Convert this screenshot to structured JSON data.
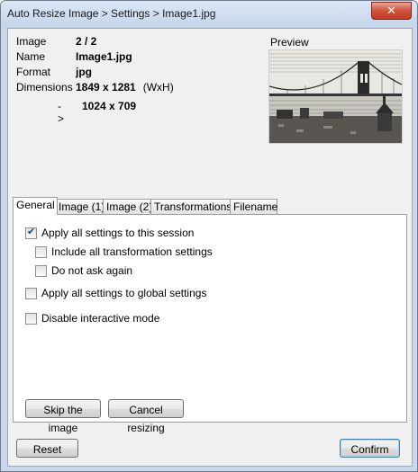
{
  "window": {
    "title": "Auto Resize Image > Settings > Image1.jpg",
    "close_glyph": "✕"
  },
  "info": {
    "image_label": "Image",
    "image_value": "2 / 2",
    "name_label": "Name",
    "name_value": "Image1.jpg",
    "format_label": "Format",
    "format_value": "jpg",
    "dimensions_label": "Dimensions",
    "dimensions_value": "1849 x 1281",
    "dimensions_unit": "(WxH)",
    "arrow": "->",
    "new_dimensions": "1024 x 709"
  },
  "preview": {
    "label": "Preview"
  },
  "tabs": [
    {
      "label": "General",
      "active": true
    },
    {
      "label": "Image (1)",
      "active": false
    },
    {
      "label": "Image (2)",
      "active": false
    },
    {
      "label": "Transformations",
      "active": false
    },
    {
      "label": "Filename",
      "active": false
    }
  ],
  "options": {
    "apply_session": {
      "label": "Apply all settings to this session",
      "checked": true
    },
    "include_transform": {
      "label": "Include all transformation settings",
      "checked": false
    },
    "do_not_ask": {
      "label": "Do not ask again",
      "checked": false
    },
    "apply_global": {
      "label": "Apply all settings to global settings",
      "checked": false
    },
    "disable_interactive": {
      "label": "Disable interactive mode",
      "checked": false
    }
  },
  "buttons": {
    "skip": "Skip the image",
    "cancel": "Cancel resizing",
    "reset": "Reset",
    "confirm": "Confirm"
  }
}
